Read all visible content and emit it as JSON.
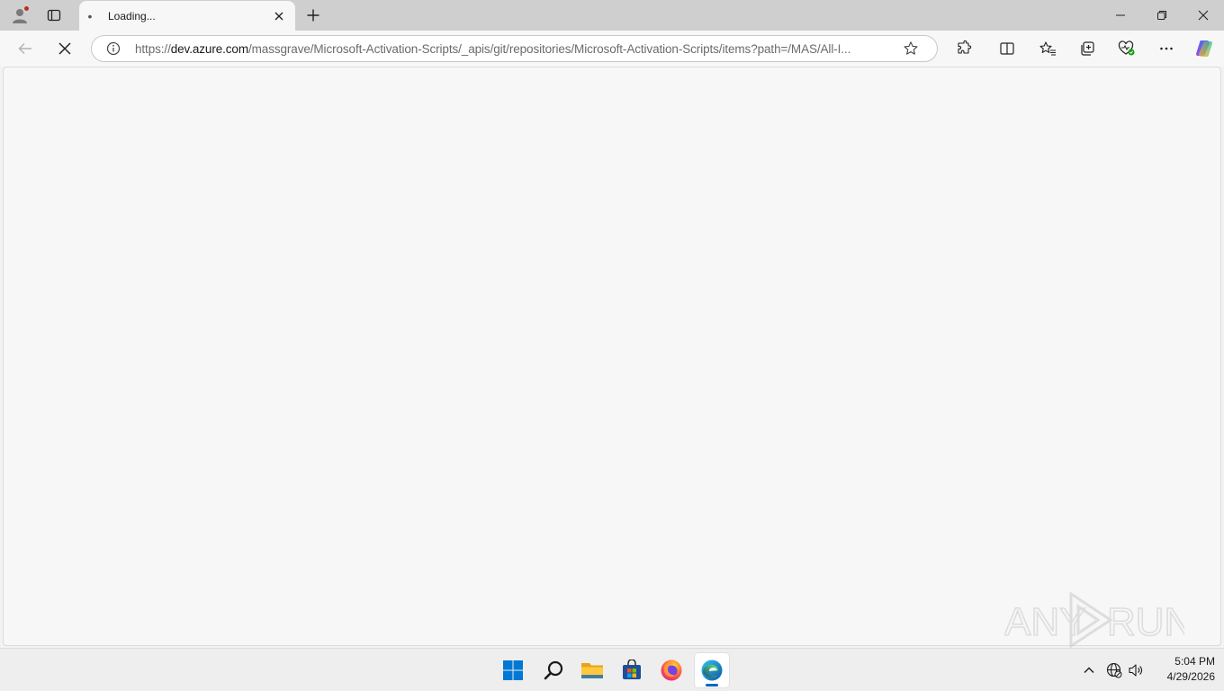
{
  "browser": {
    "tab": {
      "title": "Loading...",
      "favicon_glyph": "•",
      "close_icon": "close-icon"
    },
    "new_tab_icon": "plus-icon",
    "window_controls": [
      "minimize-icon",
      "restore-icon",
      "close-icon"
    ]
  },
  "address_bar": {
    "scheme": "https://",
    "host": "dev.azure.com",
    "path": "/massgrave/Microsoft-Activation-Scripts/_apis/git/repositories/Microsoft-Activation-Scripts/items?path=/MAS/All-I..."
  },
  "toolbar_icons": [
    "extensions-icon",
    "split-screen-icon",
    "favorites-icon",
    "collections-icon",
    "browser-essentials-icon",
    "more-icon",
    "copilot-icon"
  ],
  "watermark": {
    "text_left": "ANY",
    "text_right": "RUN"
  },
  "taskbar": {
    "apps": [
      "windows-start-icon",
      "search-icon",
      "file-explorer-icon",
      "microsoft-store-icon",
      "firefox-icon",
      "edge-icon"
    ],
    "clock": {
      "time": "5:04 PM",
      "date": "4/29/2026"
    }
  },
  "colors": {
    "titlebar": "#cfcfcf",
    "toolbar": "#f7f7f7",
    "accent": "#0067c0"
  }
}
